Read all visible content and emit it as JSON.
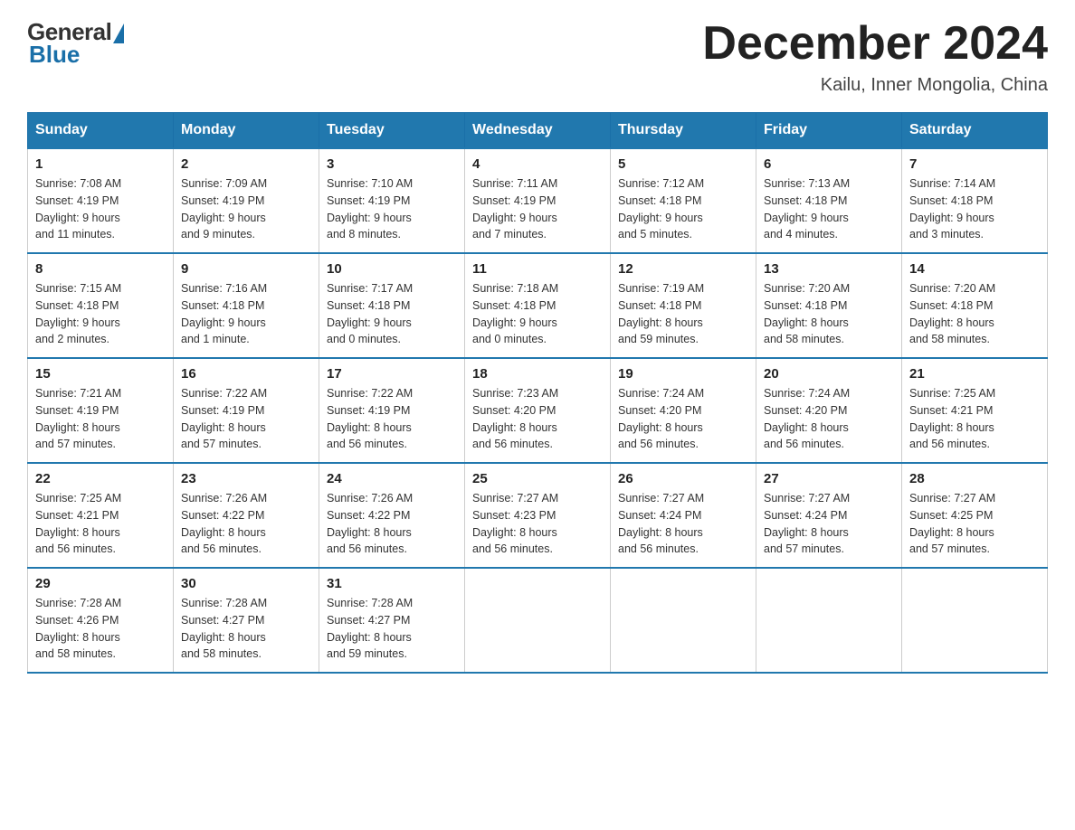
{
  "logo": {
    "general": "General",
    "blue": "Blue"
  },
  "title": "December 2024",
  "subtitle": "Kailu, Inner Mongolia, China",
  "days_of_week": [
    "Sunday",
    "Monday",
    "Tuesday",
    "Wednesday",
    "Thursday",
    "Friday",
    "Saturday"
  ],
  "weeks": [
    [
      {
        "day": "1",
        "sunrise": "7:08 AM",
        "sunset": "4:19 PM",
        "daylight": "9 hours and 11 minutes."
      },
      {
        "day": "2",
        "sunrise": "7:09 AM",
        "sunset": "4:19 PM",
        "daylight": "9 hours and 9 minutes."
      },
      {
        "day": "3",
        "sunrise": "7:10 AM",
        "sunset": "4:19 PM",
        "daylight": "9 hours and 8 minutes."
      },
      {
        "day": "4",
        "sunrise": "7:11 AM",
        "sunset": "4:19 PM",
        "daylight": "9 hours and 7 minutes."
      },
      {
        "day": "5",
        "sunrise": "7:12 AM",
        "sunset": "4:18 PM",
        "daylight": "9 hours and 5 minutes."
      },
      {
        "day": "6",
        "sunrise": "7:13 AM",
        "sunset": "4:18 PM",
        "daylight": "9 hours and 4 minutes."
      },
      {
        "day": "7",
        "sunrise": "7:14 AM",
        "sunset": "4:18 PM",
        "daylight": "9 hours and 3 minutes."
      }
    ],
    [
      {
        "day": "8",
        "sunrise": "7:15 AM",
        "sunset": "4:18 PM",
        "daylight": "9 hours and 2 minutes."
      },
      {
        "day": "9",
        "sunrise": "7:16 AM",
        "sunset": "4:18 PM",
        "daylight": "9 hours and 1 minute."
      },
      {
        "day": "10",
        "sunrise": "7:17 AM",
        "sunset": "4:18 PM",
        "daylight": "9 hours and 0 minutes."
      },
      {
        "day": "11",
        "sunrise": "7:18 AM",
        "sunset": "4:18 PM",
        "daylight": "9 hours and 0 minutes."
      },
      {
        "day": "12",
        "sunrise": "7:19 AM",
        "sunset": "4:18 PM",
        "daylight": "8 hours and 59 minutes."
      },
      {
        "day": "13",
        "sunrise": "7:20 AM",
        "sunset": "4:18 PM",
        "daylight": "8 hours and 58 minutes."
      },
      {
        "day": "14",
        "sunrise": "7:20 AM",
        "sunset": "4:18 PM",
        "daylight": "8 hours and 58 minutes."
      }
    ],
    [
      {
        "day": "15",
        "sunrise": "7:21 AM",
        "sunset": "4:19 PM",
        "daylight": "8 hours and 57 minutes."
      },
      {
        "day": "16",
        "sunrise": "7:22 AM",
        "sunset": "4:19 PM",
        "daylight": "8 hours and 57 minutes."
      },
      {
        "day": "17",
        "sunrise": "7:22 AM",
        "sunset": "4:19 PM",
        "daylight": "8 hours and 56 minutes."
      },
      {
        "day": "18",
        "sunrise": "7:23 AM",
        "sunset": "4:20 PM",
        "daylight": "8 hours and 56 minutes."
      },
      {
        "day": "19",
        "sunrise": "7:24 AM",
        "sunset": "4:20 PM",
        "daylight": "8 hours and 56 minutes."
      },
      {
        "day": "20",
        "sunrise": "7:24 AM",
        "sunset": "4:20 PM",
        "daylight": "8 hours and 56 minutes."
      },
      {
        "day": "21",
        "sunrise": "7:25 AM",
        "sunset": "4:21 PM",
        "daylight": "8 hours and 56 minutes."
      }
    ],
    [
      {
        "day": "22",
        "sunrise": "7:25 AM",
        "sunset": "4:21 PM",
        "daylight": "8 hours and 56 minutes."
      },
      {
        "day": "23",
        "sunrise": "7:26 AM",
        "sunset": "4:22 PM",
        "daylight": "8 hours and 56 minutes."
      },
      {
        "day": "24",
        "sunrise": "7:26 AM",
        "sunset": "4:22 PM",
        "daylight": "8 hours and 56 minutes."
      },
      {
        "day": "25",
        "sunrise": "7:27 AM",
        "sunset": "4:23 PM",
        "daylight": "8 hours and 56 minutes."
      },
      {
        "day": "26",
        "sunrise": "7:27 AM",
        "sunset": "4:24 PM",
        "daylight": "8 hours and 56 minutes."
      },
      {
        "day": "27",
        "sunrise": "7:27 AM",
        "sunset": "4:24 PM",
        "daylight": "8 hours and 57 minutes."
      },
      {
        "day": "28",
        "sunrise": "7:27 AM",
        "sunset": "4:25 PM",
        "daylight": "8 hours and 57 minutes."
      }
    ],
    [
      {
        "day": "29",
        "sunrise": "7:28 AM",
        "sunset": "4:26 PM",
        "daylight": "8 hours and 58 minutes."
      },
      {
        "day": "30",
        "sunrise": "7:28 AM",
        "sunset": "4:27 PM",
        "daylight": "8 hours and 58 minutes."
      },
      {
        "day": "31",
        "sunrise": "7:28 AM",
        "sunset": "4:27 PM",
        "daylight": "8 hours and 59 minutes."
      },
      null,
      null,
      null,
      null
    ]
  ],
  "labels": {
    "sunrise": "Sunrise:",
    "sunset": "Sunset:",
    "daylight": "Daylight:"
  }
}
